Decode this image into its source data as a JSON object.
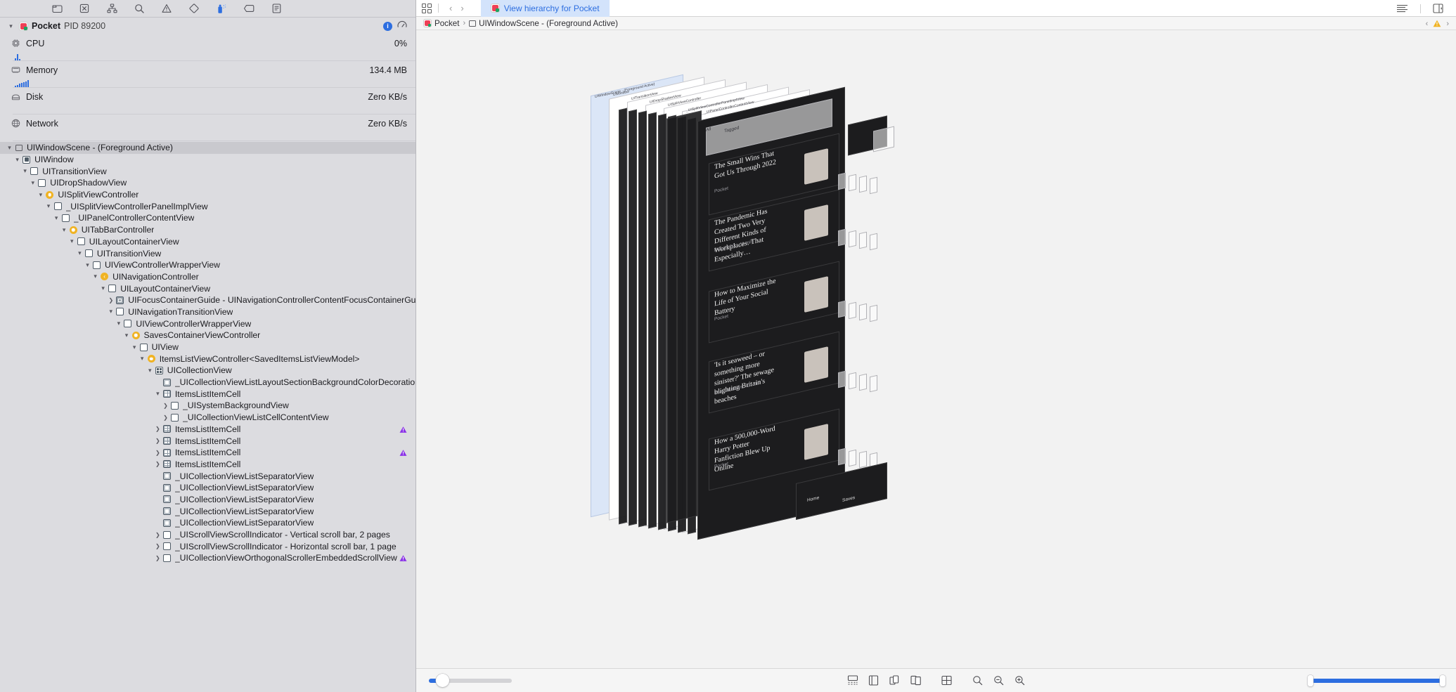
{
  "navigator": {
    "toolbar_icons": [
      {
        "name": "folder-icon",
        "glyph": "folder"
      },
      {
        "name": "cpu-report-icon",
        "glyph": "boxed-x"
      },
      {
        "name": "thread-icon",
        "glyph": "hierarchy"
      },
      {
        "name": "search-icon",
        "glyph": "magnifier"
      },
      {
        "name": "issue-warning-icon",
        "glyph": "triangle"
      },
      {
        "name": "test-icon",
        "glyph": "diamond"
      },
      {
        "name": "debug-icon",
        "glyph": "spray"
      },
      {
        "name": "breakpoint-icon",
        "glyph": "tag"
      },
      {
        "name": "report-icon",
        "glyph": "list-doc"
      }
    ],
    "process": {
      "icon": "pocket-app-icon",
      "name": "Pocket",
      "pid_label": "PID 89200",
      "info_badge": "i"
    },
    "gauges": [
      {
        "icon": "cpu-icon",
        "label": "CPU",
        "value": "0%",
        "spark": [
          3,
          9,
          2
        ]
      },
      {
        "icon": "memory-icon",
        "label": "Memory",
        "value": "134.4 MB",
        "spark": [
          2,
          3,
          5,
          6,
          7,
          8,
          10
        ]
      },
      {
        "icon": "disk-icon",
        "label": "Disk",
        "value": "Zero KB/s",
        "spark": []
      },
      {
        "icon": "network-icon",
        "label": "Network",
        "value": "Zero KB/s",
        "spark": []
      }
    ],
    "tree": [
      {
        "depth": 0,
        "twist": "down",
        "icon": "scene",
        "label": "UIWindowScene - (Foreground Active)",
        "selected": true,
        "warn": false
      },
      {
        "depth": 1,
        "twist": "down",
        "icon": "window",
        "label": "UIWindow",
        "selected": false,
        "warn": false
      },
      {
        "depth": 2,
        "twist": "down",
        "icon": "view",
        "label": "UITransitionView",
        "selected": false,
        "warn": false
      },
      {
        "depth": 3,
        "twist": "down",
        "icon": "view",
        "label": "UIDropShadowView",
        "selected": false,
        "warn": false
      },
      {
        "depth": 4,
        "twist": "down",
        "icon": "vc",
        "label": "UISplitViewController",
        "selected": false,
        "warn": false
      },
      {
        "depth": 5,
        "twist": "down",
        "icon": "view",
        "label": "_UISplitViewControllerPanelImplView",
        "selected": false,
        "warn": false
      },
      {
        "depth": 6,
        "twist": "down",
        "icon": "view",
        "label": "_UIPanelControllerContentView",
        "selected": false,
        "warn": false
      },
      {
        "depth": 7,
        "twist": "down",
        "icon": "vc",
        "label": "UITabBarController",
        "selected": false,
        "warn": false
      },
      {
        "depth": 8,
        "twist": "down",
        "icon": "view",
        "label": "UILayoutContainerView",
        "selected": false,
        "warn": false
      },
      {
        "depth": 9,
        "twist": "down",
        "icon": "view",
        "label": "UITransitionView",
        "selected": false,
        "warn": false
      },
      {
        "depth": 10,
        "twist": "down",
        "icon": "view",
        "label": "UIViewControllerWrapperView",
        "selected": false,
        "warn": false
      },
      {
        "depth": 11,
        "twist": "down",
        "icon": "nav",
        "label": "UINavigationController",
        "selected": false,
        "warn": false
      },
      {
        "depth": 12,
        "twist": "down",
        "icon": "view",
        "label": "UILayoutContainerView",
        "selected": false,
        "warn": false
      },
      {
        "depth": 13,
        "twist": "right",
        "icon": "guide",
        "label": "UIFocusContainerGuide - UINavigationControllerContentFocusContainerGuide",
        "selected": false,
        "warn": false
      },
      {
        "depth": 13,
        "twist": "down",
        "icon": "view",
        "label": "UINavigationTransitionView",
        "selected": false,
        "warn": false
      },
      {
        "depth": 14,
        "twist": "down",
        "icon": "view",
        "label": "UIViewControllerWrapperView",
        "selected": false,
        "warn": false
      },
      {
        "depth": 15,
        "twist": "down",
        "icon": "vc",
        "label": "SavesContainerViewController",
        "selected": false,
        "warn": false
      },
      {
        "depth": 16,
        "twist": "down",
        "icon": "view",
        "label": "UIView",
        "selected": false,
        "warn": false
      },
      {
        "depth": 17,
        "twist": "down",
        "icon": "vc",
        "label": "ItemsListViewController<SavedItemsListViewModel>",
        "selected": false,
        "warn": false
      },
      {
        "depth": 18,
        "twist": "down",
        "icon": "collection",
        "label": "UICollectionView",
        "selected": false,
        "warn": false
      },
      {
        "depth": 19,
        "twist": "none",
        "icon": "decor",
        "label": "_UICollectionViewListLayoutSectionBackgroundColorDecorationView",
        "selected": false,
        "warn": false
      },
      {
        "depth": 19,
        "twist": "down",
        "icon": "cell",
        "label": "ItemsListItemCell",
        "selected": false,
        "warn": false
      },
      {
        "depth": 20,
        "twist": "right",
        "icon": "view",
        "label": "_UISystemBackgroundView",
        "selected": false,
        "warn": false
      },
      {
        "depth": 20,
        "twist": "right",
        "icon": "view",
        "label": "_UICollectionViewListCellContentView",
        "selected": false,
        "warn": false
      },
      {
        "depth": 19,
        "twist": "right",
        "icon": "cell",
        "label": "ItemsListItemCell",
        "selected": false,
        "warn": true
      },
      {
        "depth": 19,
        "twist": "right",
        "icon": "cell",
        "label": "ItemsListItemCell",
        "selected": false,
        "warn": false
      },
      {
        "depth": 19,
        "twist": "right",
        "icon": "cell",
        "label": "ItemsListItemCell",
        "selected": false,
        "warn": true
      },
      {
        "depth": 19,
        "twist": "right",
        "icon": "cell",
        "label": "ItemsListItemCell",
        "selected": false,
        "warn": false
      },
      {
        "depth": 19,
        "twist": "none",
        "icon": "decor",
        "label": "_UICollectionViewListSeparatorView",
        "selected": false,
        "warn": false
      },
      {
        "depth": 19,
        "twist": "none",
        "icon": "decor",
        "label": "_UICollectionViewListSeparatorView",
        "selected": false,
        "warn": false
      },
      {
        "depth": 19,
        "twist": "none",
        "icon": "decor",
        "label": "_UICollectionViewListSeparatorView",
        "selected": false,
        "warn": false
      },
      {
        "depth": 19,
        "twist": "none",
        "icon": "decor",
        "label": "_UICollectionViewListSeparatorView",
        "selected": false,
        "warn": false
      },
      {
        "depth": 19,
        "twist": "none",
        "icon": "decor",
        "label": "_UICollectionViewListSeparatorView",
        "selected": false,
        "warn": false
      },
      {
        "depth": 19,
        "twist": "right",
        "icon": "view",
        "label": "_UIScrollViewScrollIndicator - Vertical scroll bar, 2 pages",
        "selected": false,
        "warn": false
      },
      {
        "depth": 19,
        "twist": "right",
        "icon": "view",
        "label": "_UIScrollViewScrollIndicator - Horizontal scroll bar, 1 page",
        "selected": false,
        "warn": false
      },
      {
        "depth": 19,
        "twist": "right",
        "icon": "view",
        "label": "_UICollectionViewOrthogonalScrollerEmbeddedScrollView",
        "selected": false,
        "warn": true
      }
    ]
  },
  "inspector": {
    "toolbar": {
      "grid_icon": "assistant-grid-icon",
      "back_label": "‹",
      "forward_label": "›",
      "tab_label": "View hierarchy for Pocket",
      "tab_icon": "pocket-app-icon",
      "right_icons": [
        {
          "name": "inspector-lines-icon"
        },
        {
          "name": "add-editor-icon"
        }
      ]
    },
    "breadcrumb": {
      "items": [
        {
          "icon": "pocket-app-icon",
          "label": "Pocket"
        },
        {
          "icon": "scene-icon",
          "label": "UIWindowScene - (Foreground Active)"
        }
      ],
      "separator": "›",
      "prev_label": "‹",
      "next_label": "›",
      "warning_icon": "warning-triangle-icon"
    },
    "canvas": {
      "window_labels": [
        "UIWindowScene - (Foreground Active)",
        "UIWindow",
        "UITransitionView",
        "UIDropShadowView",
        "UISplitViewController",
        "_UISplitViewControllerPanelImplView",
        "_UIPanelControllerContentView"
      ],
      "cards": [
        {
          "title": "The Small Wins That Got Us Through 2022",
          "source": "Pocket"
        },
        {
          "title": "The Pandemic Has Created Two Very Different Kinds of Workplaces. That Especially…",
          "source": "POLITICO · 11 min"
        },
        {
          "title": "How to Maximize the Life of Your Social Battery",
          "source": "Pocket"
        },
        {
          "title": "'Is it seaweed – or something more sinister?' The sewage blighting Britain's beaches",
          "source": "The Guardian · 10 min"
        },
        {
          "title": "How a 500,000-Word Harry Potter Fanfiction Blew Up Online",
          "source": "Pocket"
        }
      ],
      "filter_chips": [
        "All",
        "Tagged"
      ],
      "tab_labels": [
        "Home",
        "Saves"
      ]
    },
    "bottombar": {
      "zoom_slider_value": 12,
      "tools": [
        {
          "name": "show-clipped-content-icon"
        },
        {
          "name": "show-constraints-icon"
        },
        {
          "name": "view-mode-icon"
        },
        {
          "name": "show-layers-icon"
        },
        {
          "name": "reset-viewing-area-icon"
        },
        {
          "name": "zoom-fit-icon"
        },
        {
          "name": "zoom-out-icon"
        },
        {
          "name": "zoom-in-icon"
        }
      ],
      "range_slider_min": 0,
      "range_slider_max": 100
    }
  },
  "colors": {
    "accent": "#2d6ee0",
    "warning": "#f0b323",
    "violet_warning": "#8b32e8",
    "nav_bg": "#dcdce0",
    "canvas_bg": "#f2f2f2"
  }
}
